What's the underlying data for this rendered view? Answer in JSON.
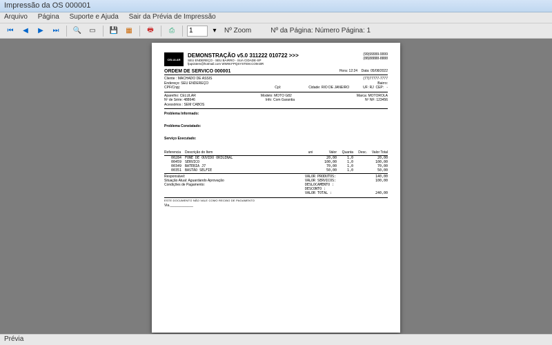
{
  "window": {
    "title": "Impressão da OS 000001"
  },
  "menu": {
    "arquivo": "Arquivo",
    "pagina": "Página",
    "suporte": "Suporte e Ajuda",
    "sair": "Sair da Prévia de Impressão"
  },
  "toolbar": {
    "page_input": "1",
    "zoom_label": "Nº Zoom",
    "page_label": "Nº da Página: Número Página: 1"
  },
  "statusbar": {
    "text": "Prévia"
  },
  "doc": {
    "header": {
      "title": "DEMONSTRAÇÃO v5.0 311222 010722 >>>",
      "sub1": "SEU ENDEREÇO - SEU BAIRRO - SUA CIDADE-SP",
      "sub2": "fpqsistem@hotmail.com    WWW.FPQSYSTEM.COM.BR",
      "phone1": "(99)99999-9999",
      "phone2": "(88)88888-8888"
    },
    "os": {
      "title": "ORDEM DE SERVICO 000001",
      "hora": "Hora: 12:24",
      "data": "Data: 05/08/2022"
    },
    "cliente": {
      "nome_lbl": "Cliente :",
      "nome": "MACHADO DE ASSIS",
      "end_lbl": "Endereço:",
      "end": "SEU ENDEREÇO",
      "cpf_lbl": "CPF/Cnpj:",
      "tel": "(77)77777-7777",
      "bairro_lbl": "Bairro:",
      "cpl_lbl": "Cpl:",
      "cidade_lbl": "Cidade:",
      "cidade": "RIO DE JANEIRO",
      "uf_lbl": "UF:",
      "uf": "RJ",
      "cep_lbl": "CEP:",
      "cep": "-"
    },
    "aparelho": {
      "ap_lbl": "Aparelho:",
      "ap": "CELULAR",
      "modelo_lbl": "Modelo:",
      "modelo": "MOTO G82",
      "marca_lbl": "Marca:",
      "marca": "MOTOROLA",
      "serie_lbl": "Nº de Série:",
      "serie": "488646",
      "info_lbl": "Info:",
      "info": "Com Garantia",
      "nf_lbl": "Nº NF:",
      "nf": "123456",
      "acess_lbl": "Acessórios :",
      "acess": "SEM CABOS"
    },
    "labels": {
      "prob_inf": "Problema Informado:",
      "prob_con": "Problema Constatado:",
      "serv_exe": "Serviço Executado:"
    },
    "items_hdr": {
      "ref": "Referencia",
      "desc": "Descrição do Item",
      "uni": "uni",
      "valor": "Valor",
      "quant": "Quanta",
      "desc2": "Desc.",
      "total": "Valor Total"
    },
    "items": [
      {
        "ref": "00284",
        "desc": "FONE DE OUVIDO ORIGINAL",
        "valor": "20,00",
        "quant": "1,0",
        "total": "20,00"
      },
      {
        "ref": "00459",
        "desc": "SERVICO",
        "valor": "100,00",
        "quant": "1,0",
        "total": "100,00"
      },
      {
        "ref": "00349",
        "desc": "BATERIA J7",
        "valor": "70,00",
        "quant": "1,0",
        "total": "70,00"
      },
      {
        "ref": "00351",
        "desc": "BASTÃO SELFIE",
        "valor": "50,00",
        "quant": "1,0",
        "total": "50,00"
      }
    ],
    "totals_left": {
      "resp": "Responsável:",
      "sit": "Situação Atual: Aguardando Aprovação",
      "cond": "Condições de Pagamento:"
    },
    "totals_right": [
      {
        "label": "VALOR PRODUTOS:",
        "val": "140,00"
      },
      {
        "label": "VALOR SERVICOS:",
        "val": "100,00"
      },
      {
        "label": "DESLOCAMENTO  :",
        "val": ""
      },
      {
        "label": "DESCONTO      :",
        "val": ""
      },
      {
        "label": "VALOR TOTAL   :",
        "val": "240,00"
      }
    ],
    "note": "ESTE DOCUMENTO NÃO VALE COMO RECIBO DE PAGAMENTO",
    "sig": "Via.____________"
  }
}
